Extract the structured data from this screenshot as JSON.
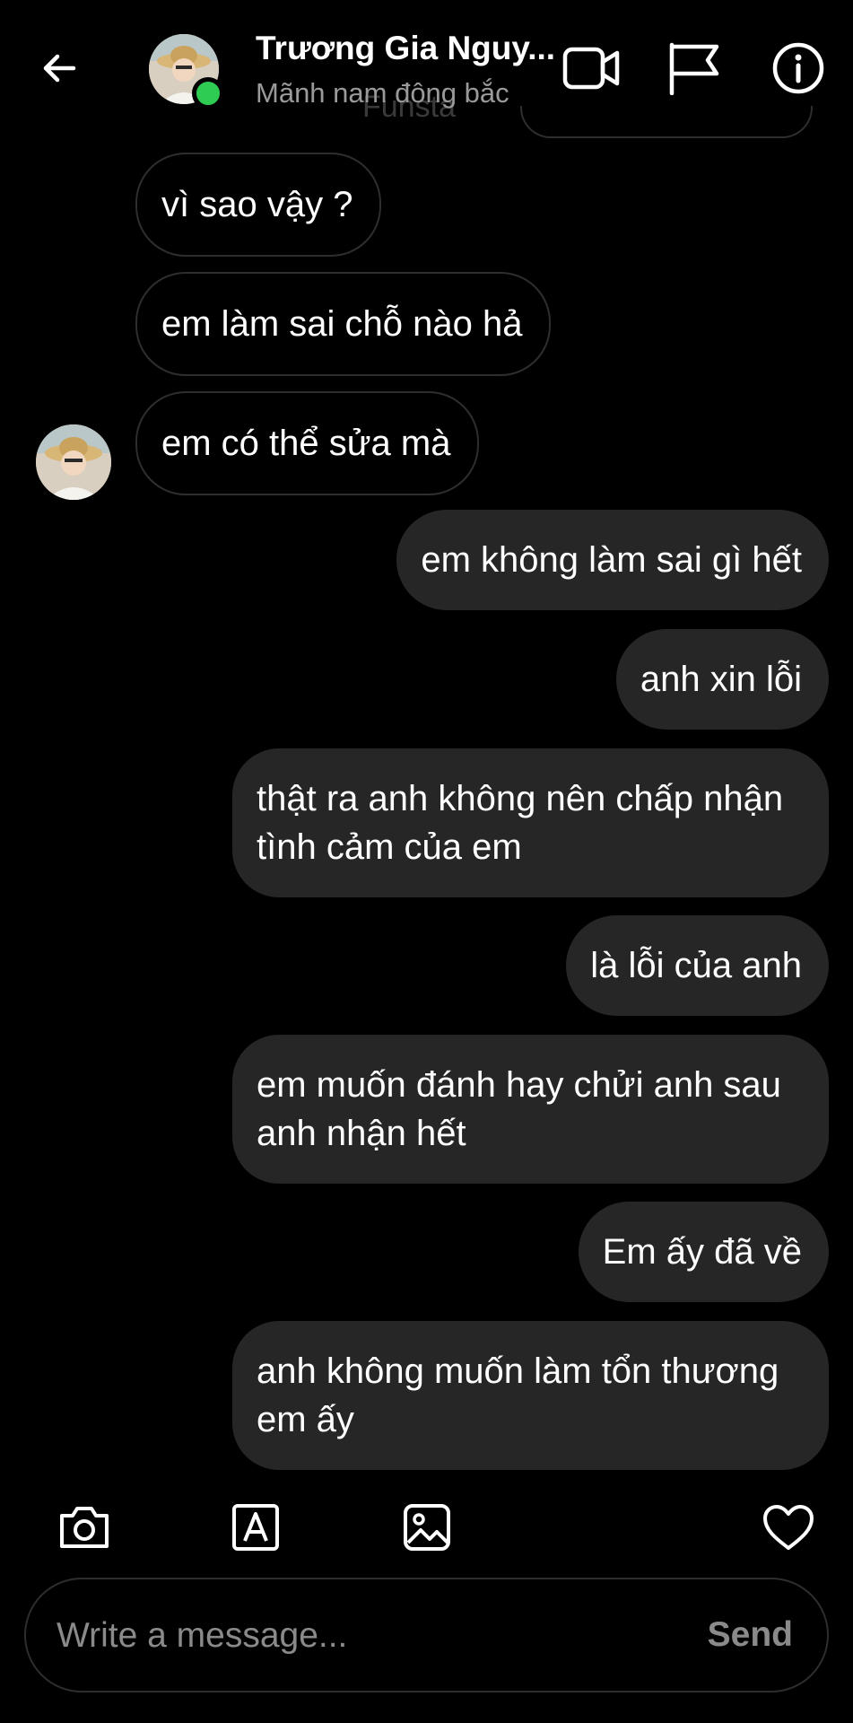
{
  "header": {
    "title": "Trương Gia Nguy...",
    "subtitle": "Mãnh nam đông bắc",
    "ghost_text": "Funsta",
    "online_color": "#2ecc52"
  },
  "messages": [
    {
      "side": "in",
      "text": "vì sao vậy ?"
    },
    {
      "side": "in",
      "text": "em làm sai chỗ nào hả"
    },
    {
      "side": "in",
      "text": "em có thể sửa mà"
    },
    {
      "side": "out",
      "text": "em không làm sai gì hết"
    },
    {
      "side": "out",
      "text": "anh xin lỗi"
    },
    {
      "side": "out",
      "text": "thật ra anh không nên chấp nhận tình cảm của em"
    },
    {
      "side": "out",
      "text": "là lỗi của anh"
    },
    {
      "side": "out",
      "text": "em muốn đánh hay chửi anh sau anh nhận hết"
    },
    {
      "side": "out",
      "text": "Em ấy đã về"
    },
    {
      "side": "out",
      "text": "anh không muốn làm tổn thương em ấy"
    }
  ],
  "toolbar": {
    "icons": [
      "camera-icon",
      "text-style-icon",
      "gallery-icon",
      "heart-icon"
    ]
  },
  "composer": {
    "placeholder": "Write a message...",
    "send_label": "Send"
  },
  "colors": {
    "background": "#000000",
    "outgoing_bubble": "#262626",
    "incoming_border": "#2e2e2e",
    "muted_text": "#8a8a8a"
  }
}
